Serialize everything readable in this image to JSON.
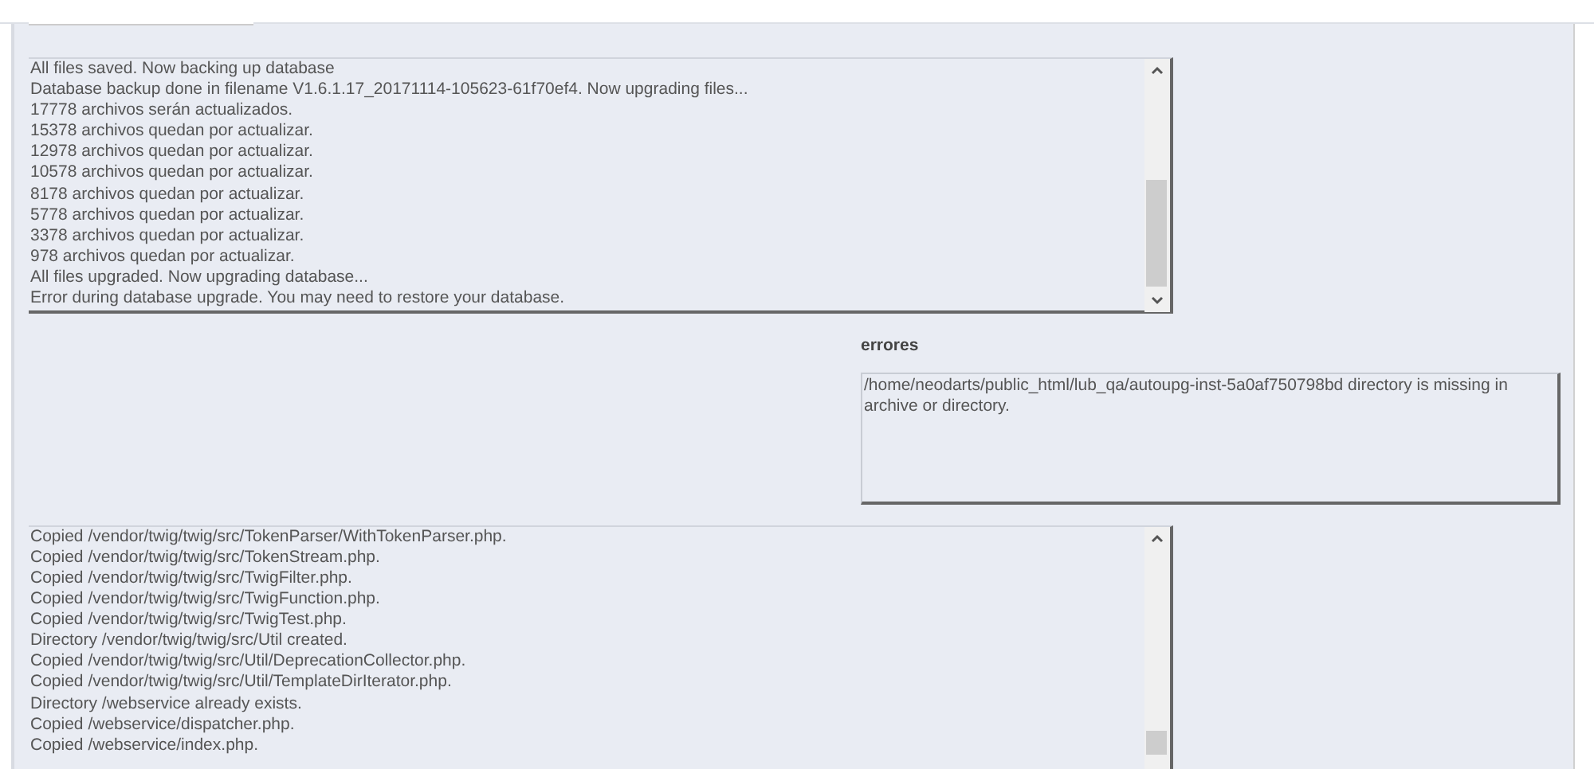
{
  "upgrade_log": {
    "lines": [
      "All files saved. Now backing up database",
      "Database backup done in filename V1.6.1.17_20171114-105623-61f70ef4. Now upgrading files...",
      "17778 archivos serán actualizados.",
      "15378 archivos quedan por actualizar.",
      "12978 archivos quedan por actualizar.",
      "10578 archivos quedan por actualizar.",
      "8178 archivos quedan por actualizar.",
      "5778 archivos quedan por actualizar.",
      "3378 archivos quedan por actualizar.",
      "978 archivos quedan por actualizar.",
      "All files upgraded. Now upgrading database...",
      "Error during database upgrade. You may need to restore your database."
    ]
  },
  "errors": {
    "title": "errores",
    "text": "/home/neodarts/public_html/lub_qa/autoupg-inst-5a0af750798bd directory is missing in archive or directory."
  },
  "file_log": {
    "lines": [
      "Copied /vendor/twig/twig/src/TokenParser/WithTokenParser.php.",
      "Copied /vendor/twig/twig/src/TokenStream.php.",
      "Copied /vendor/twig/twig/src/TwigFilter.php.",
      "Copied /vendor/twig/twig/src/TwigFunction.php.",
      "Copied /vendor/twig/twig/src/TwigTest.php.",
      "Directory /vendor/twig/twig/src/Util created.",
      "Copied /vendor/twig/twig/src/Util/DeprecationCollector.php.",
      "Copied /vendor/twig/twig/src/Util/TemplateDirIterator.php.",
      "Directory /webservice already exists.",
      "Copied /webservice/dispatcher.php.",
      "Copied /webservice/index.php."
    ]
  }
}
